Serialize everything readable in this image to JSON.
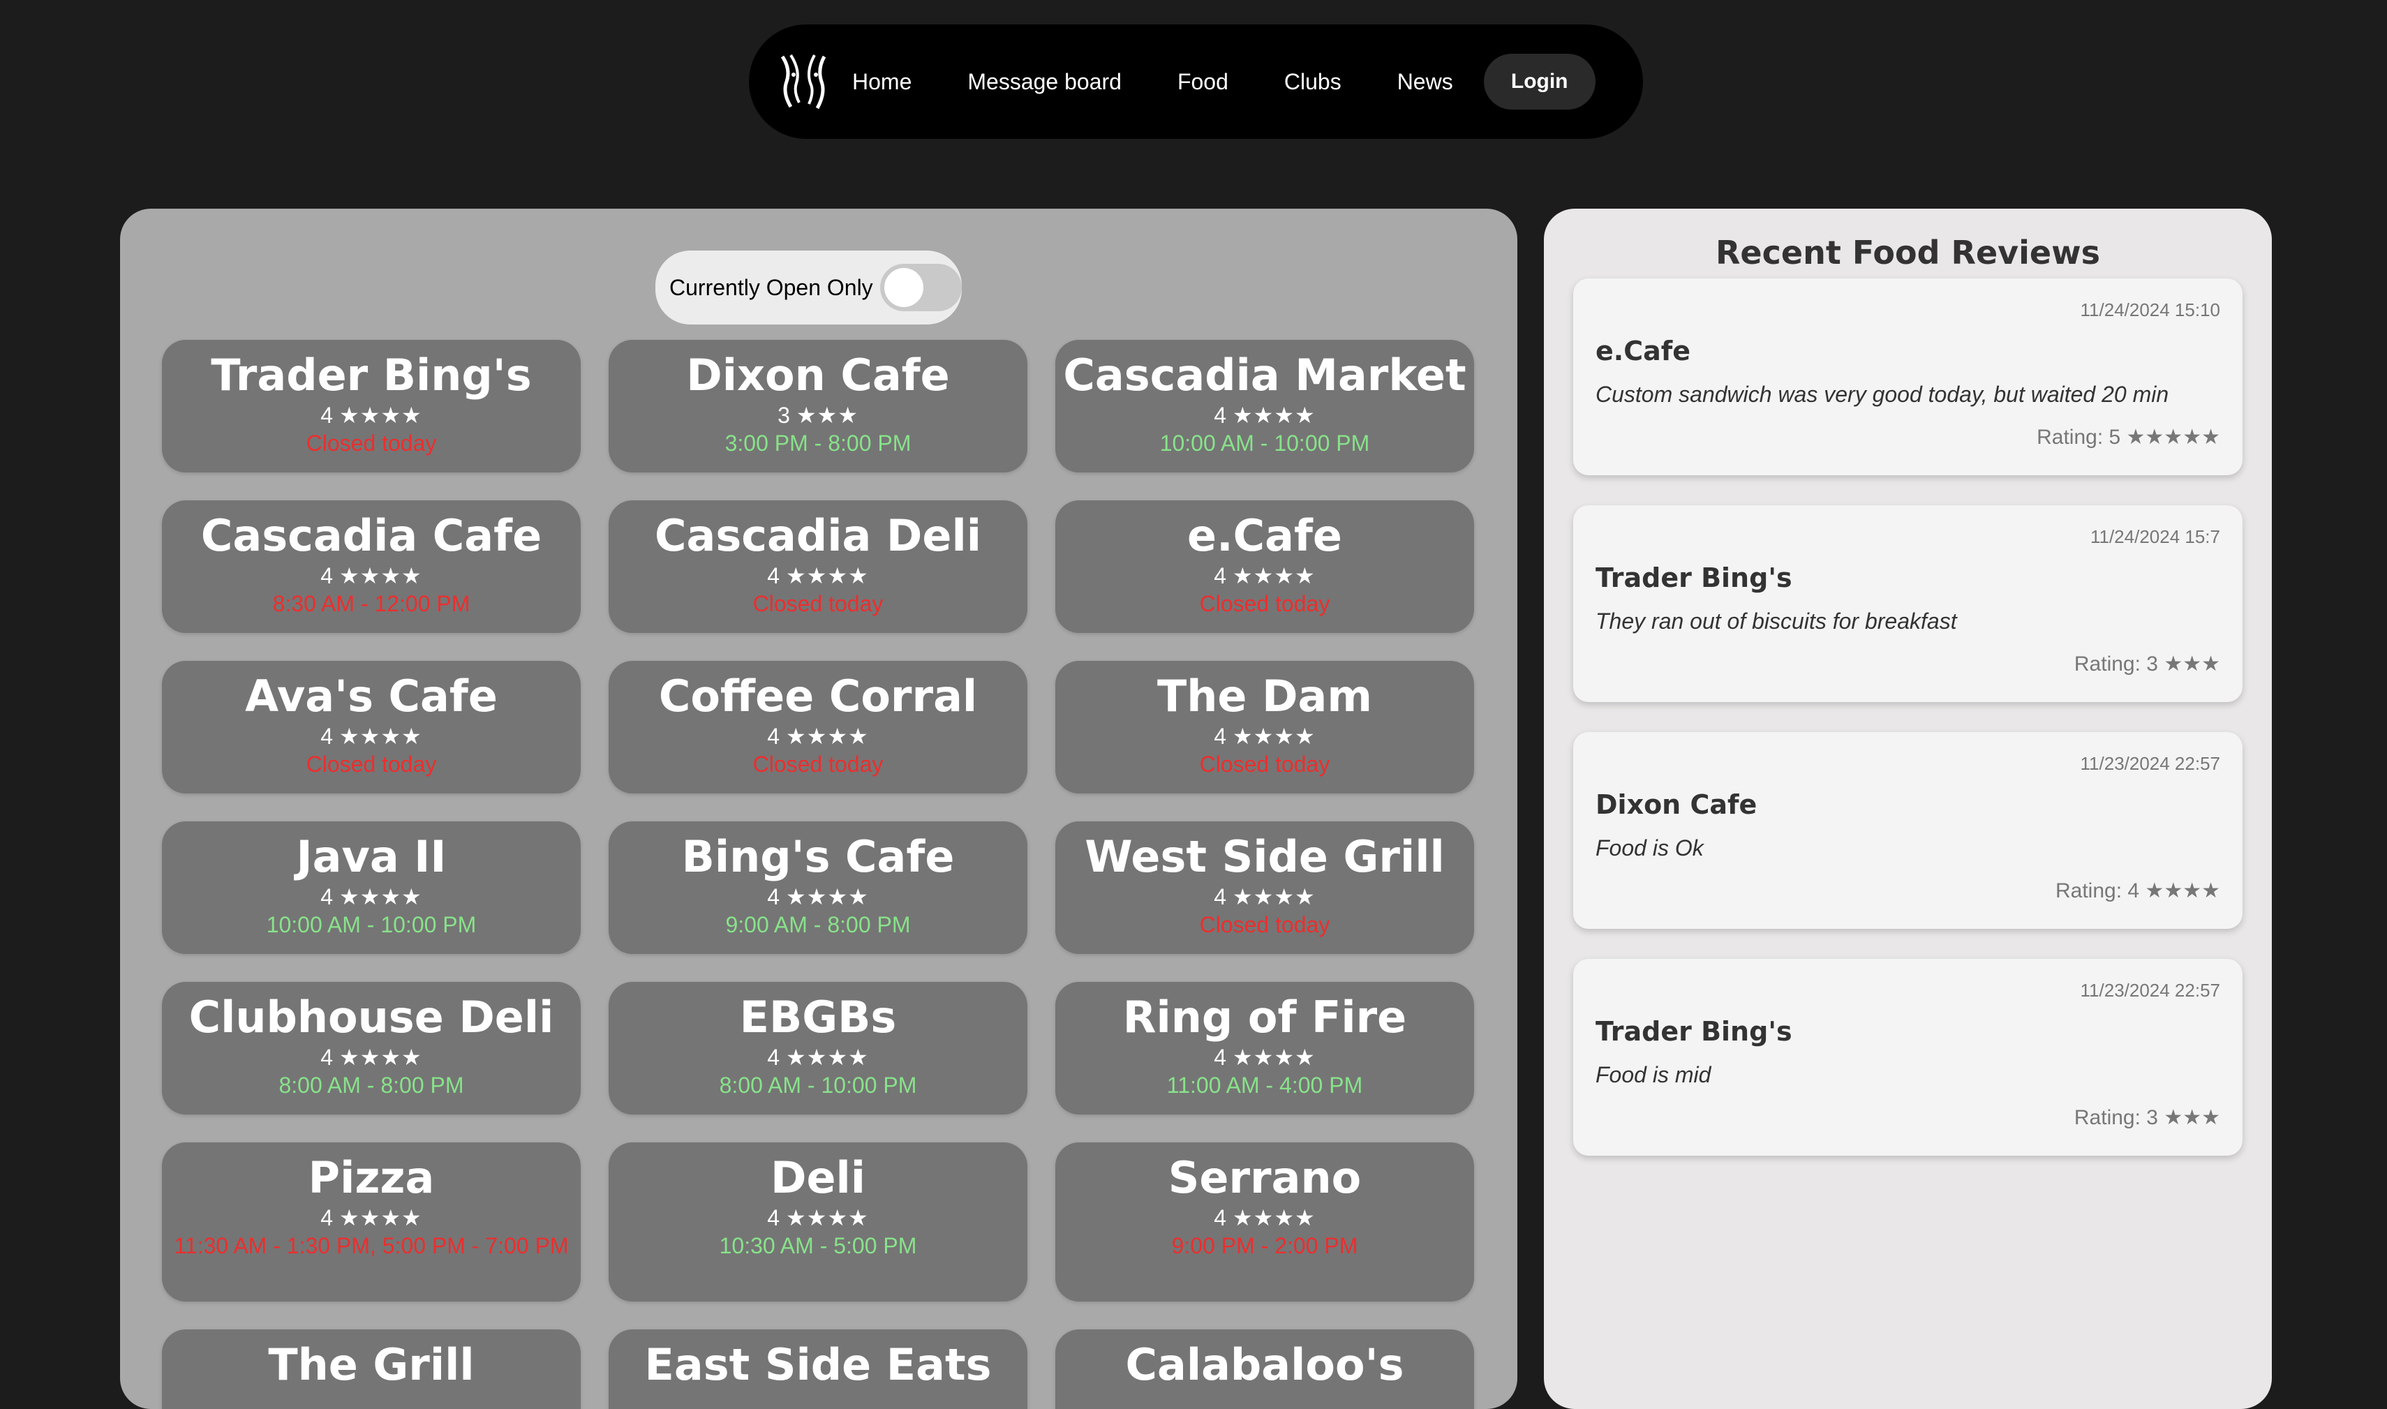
{
  "nav": {
    "links": [
      "Home",
      "Message board",
      "Food",
      "Clubs",
      "News"
    ],
    "login_label": "Login"
  },
  "filter": {
    "label": "Currently Open Only",
    "enabled": false
  },
  "restaurants": [
    {
      "name": "Trader Bing's",
      "rating": "4",
      "stars": "★★★★",
      "hours": "Closed today",
      "status": "closed"
    },
    {
      "name": "Dixon Cafe",
      "rating": "3",
      "stars": "★★★",
      "hours": "3:00 PM - 8:00 PM",
      "status": "open"
    },
    {
      "name": "Cascadia Market",
      "rating": "4",
      "stars": "★★★★",
      "hours": "10:00 AM - 10:00 PM",
      "status": "open"
    },
    {
      "name": "Cascadia Cafe",
      "rating": "4",
      "stars": "★★★★",
      "hours": "8:30 AM - 12:00 PM",
      "status": "closed"
    },
    {
      "name": "Cascadia Deli",
      "rating": "4",
      "stars": "★★★★",
      "hours": "Closed today",
      "status": "closed"
    },
    {
      "name": "e.Cafe",
      "rating": "4",
      "stars": "★★★★",
      "hours": "Closed today",
      "status": "closed"
    },
    {
      "name": "Ava's Cafe",
      "rating": "4",
      "stars": "★★★★",
      "hours": "Closed today",
      "status": "closed"
    },
    {
      "name": "Coffee Corral",
      "rating": "4",
      "stars": "★★★★",
      "hours": "Closed today",
      "status": "closed"
    },
    {
      "name": "The Dam",
      "rating": "4",
      "stars": "★★★★",
      "hours": "Closed today",
      "status": "closed"
    },
    {
      "name": "Java II",
      "rating": "4",
      "stars": "★★★★",
      "hours": "10:00 AM - 10:00 PM",
      "status": "open"
    },
    {
      "name": "Bing's Cafe",
      "rating": "4",
      "stars": "★★★★",
      "hours": "9:00 AM - 8:00 PM",
      "status": "open"
    },
    {
      "name": "West Side Grill",
      "rating": "4",
      "stars": "★★★★",
      "hours": "Closed today",
      "status": "closed"
    },
    {
      "name": "Clubhouse Deli",
      "rating": "4",
      "stars": "★★★★",
      "hours": "8:00 AM - 8:00 PM",
      "status": "open"
    },
    {
      "name": "EBGBs",
      "rating": "4",
      "stars": "★★★★",
      "hours": "8:00 AM - 10:00 PM",
      "status": "open"
    },
    {
      "name": "Ring of Fire",
      "rating": "4",
      "stars": "★★★★",
      "hours": "11:00 AM - 4:00 PM",
      "status": "open"
    },
    {
      "name": "Pizza",
      "rating": "4",
      "stars": "★★★★",
      "hours": "11:30 AM - 1:30 PM, 5:00 PM - 7:00 PM",
      "status": "closed"
    },
    {
      "name": "Deli",
      "rating": "4",
      "stars": "★★★★",
      "hours": "10:30 AM - 5:00 PM",
      "status": "open"
    },
    {
      "name": "Serrano",
      "rating": "4",
      "stars": "★★★★",
      "hours": "9:00 PM - 2:00 PM",
      "status": "closed"
    },
    {
      "name": "The Grill",
      "rating": "",
      "stars": "",
      "hours": "",
      "status": "closed"
    },
    {
      "name": "East Side Eats",
      "rating": "",
      "stars": "",
      "hours": "",
      "status": "closed"
    },
    {
      "name": "Calabaloo's",
      "rating": "",
      "stars": "",
      "hours": "",
      "status": "closed"
    }
  ],
  "reviews": {
    "title": "Recent Food Reviews",
    "items": [
      {
        "date": "11/24/2024 15:10",
        "place": "e.Cafe",
        "text": "Custom sandwich was very good today, but waited 20 min",
        "rating_label": "Rating: 5",
        "stars": "★★★★★"
      },
      {
        "date": "11/24/2024 15:7",
        "place": "Trader Bing's",
        "text": "They ran out of biscuits for breakfast",
        "rating_label": "Rating: 3",
        "stars": "★★★"
      },
      {
        "date": "11/23/2024 22:57",
        "place": "Dixon Cafe",
        "text": "Food is Ok",
        "rating_label": "Rating: 4",
        "stars": "★★★★"
      },
      {
        "date": "11/23/2024 22:57",
        "place": "Trader Bing's",
        "text": "Food is mid",
        "rating_label": "Rating: 3",
        "stars": "★★★"
      }
    ]
  },
  "colors": {
    "open": "#88e28a",
    "closed": "#ec2e2e",
    "card": "#757575",
    "panel": "#a9a9a9",
    "background": "#1c1c1c"
  },
  "icons": {
    "logo": "stylized-figures-logo-icon",
    "toggle": "toggle-switch"
  }
}
